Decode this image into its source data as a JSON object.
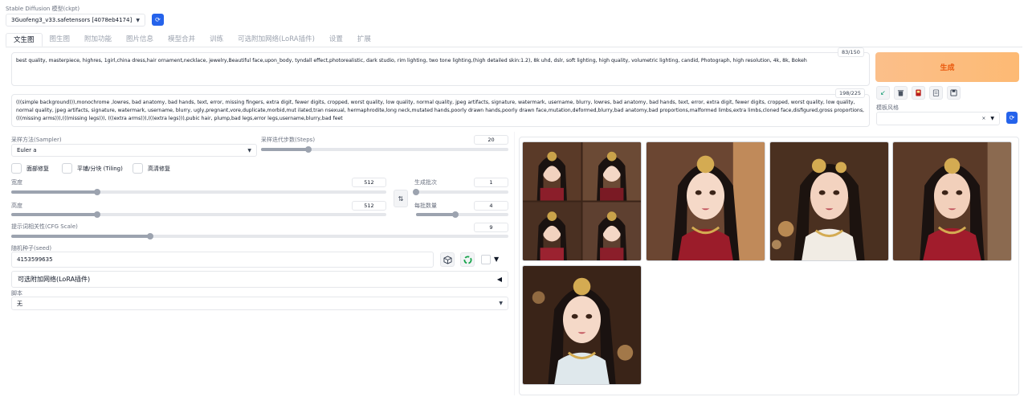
{
  "model": {
    "label": "Stable Diffusion 模型(ckpt)",
    "value": "3Guofeng3_v33.safetensors [4078eb4174]",
    "refresh_icon": "refresh-icon"
  },
  "tabs": [
    "文生图",
    "图生图",
    "附加功能",
    "图片信息",
    "模型合并",
    "训练",
    "可选附加网络(LoRA插件)",
    "设置",
    "扩展"
  ],
  "active_tab": "文生图",
  "prompt": {
    "counter": "83/150",
    "text": "best quality, masterpiece, highres, 1girl,china dress,hair ornament,necklace, jewelry,Beautiful face,upon_body, tyndall effect,photorealistic, dark studio, rim lighting, two tone lighting,(high detailed skin:1.2), 8k uhd, dslr, soft lighting, high quality, volumetric lighting, candid, Photograph, high resolution, 4k, 8k, Bokeh"
  },
  "negative_prompt": {
    "counter": "198/225",
    "text": "(((simple background))),monochrome ,lowres, bad anatomy, bad hands, text, error, missing fingers, extra digit, fewer digits, cropped, worst quality, low quality, normal quality, jpeg artifacts, signature, watermark, username, blurry, lowres, bad anatomy, bad hands, text, error, extra digit, fewer digits, cropped, worst quality, low quality, normal quality, jpeg artifacts, signature, watermark, username, blurry, ugly,pregnant,vore,duplicate,morbid,mut ilated,tran nsexual, hermaphrodite,long neck,mutated hands,poorly drawn hands,poorly drawn face,mutation,deformed,blurry,bad anatomy,bad proportions,malformed limbs,extra limbs,cloned face,disfigured,gross proportions, (((missing arms))),(((missing legs))), (((extra arms))),(((extra legs))),pubic hair, plump,bad legs,error legs,username,blurry,bad feet"
  },
  "generate": {
    "label": "生成"
  },
  "toolbar": {
    "icons": [
      "arrow-icon",
      "trash-icon",
      "red-card-icon",
      "clipboard-icon",
      "save-icon"
    ]
  },
  "style": {
    "label": "模板风格",
    "clear": "×"
  },
  "sampler": {
    "label": "采样方法(Sampler)",
    "value": "Euler a"
  },
  "steps": {
    "label": "采样迭代步数(Steps)",
    "value": "20",
    "fraction": 0.19
  },
  "checkboxes": [
    "面部修复",
    "平铺/分块 (Tiling)",
    "高清修复"
  ],
  "width": {
    "label": "宽度",
    "value": "512",
    "fraction": 0.23
  },
  "height": {
    "label": "高度",
    "value": "512",
    "fraction": 0.23
  },
  "swap_icon": "⇅",
  "batch_count": {
    "label": "生成批次",
    "value": "1",
    "fraction": 0.0
  },
  "batch_size": {
    "label": "每批数量",
    "value": "4",
    "fraction": 0.43
  },
  "cfg": {
    "label": "提示词相关性(CFG Scale)",
    "value": "9",
    "fraction": 0.28
  },
  "seed": {
    "label": "随机种子(seed)",
    "value": "4153599635"
  },
  "lora_accordion": {
    "label": "可选附加网络(LoRA插件)",
    "arrow": "◀"
  },
  "script": {
    "label": "脚本",
    "value": "无"
  },
  "colors": {
    "accent": "#2563eb",
    "generate": "#fdba74",
    "generate_text": "#ea580c"
  }
}
